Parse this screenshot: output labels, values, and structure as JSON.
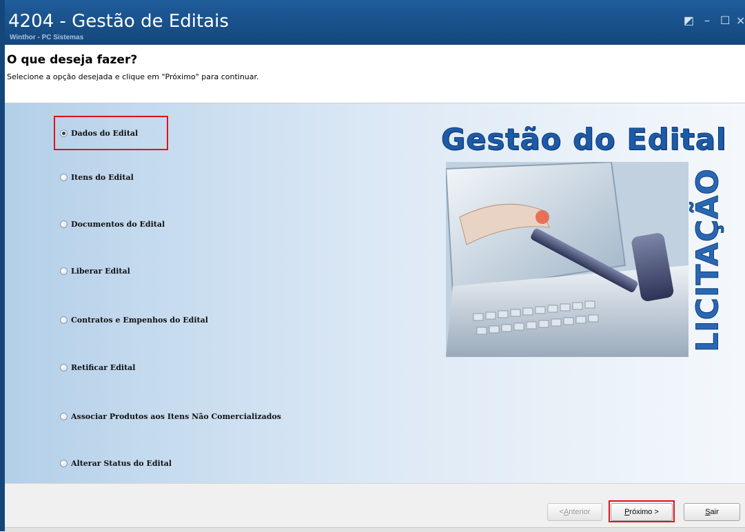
{
  "window": {
    "title": "4204 - Gestão de Editais",
    "subtitle": "Winthor - PC Sistemas",
    "controls": {
      "restore": "◩",
      "minimize": "–",
      "maximize": "☐",
      "close": "×"
    }
  },
  "header": {
    "heading": "O que deseja fazer?",
    "instruction": "Selecione a opção desejada e clique em \"Próximo\" para continuar."
  },
  "options": [
    {
      "label": "Dados do Edital",
      "checked": true
    },
    {
      "label": "Itens do Edital",
      "checked": false
    },
    {
      "label": "Documentos do Edital",
      "checked": false
    },
    {
      "label": "Liberar Edital",
      "checked": false
    },
    {
      "label": "Contratos e Empenhos do Edital",
      "checked": false
    },
    {
      "label": "Retificar Edital",
      "checked": false
    },
    {
      "label": "Associar Produtos aos Itens Não Comercializados",
      "checked": false
    },
    {
      "label": "Alterar Status do Edital",
      "checked": false
    }
  ],
  "banner": {
    "title": "Gestão do Edital",
    "vertical_text": "LICITAÇÃO"
  },
  "footer": {
    "anterior": {
      "prefix": "< ",
      "accel": "A",
      "rest": "nterior"
    },
    "proximo": {
      "accel": "P",
      "rest": "róximo >"
    },
    "sair": {
      "accel": "S",
      "rest": "air"
    }
  },
  "colors": {
    "titlebar": "#14467a",
    "highlight": "#e0121a",
    "banner_blue": "#1e5aa6"
  }
}
